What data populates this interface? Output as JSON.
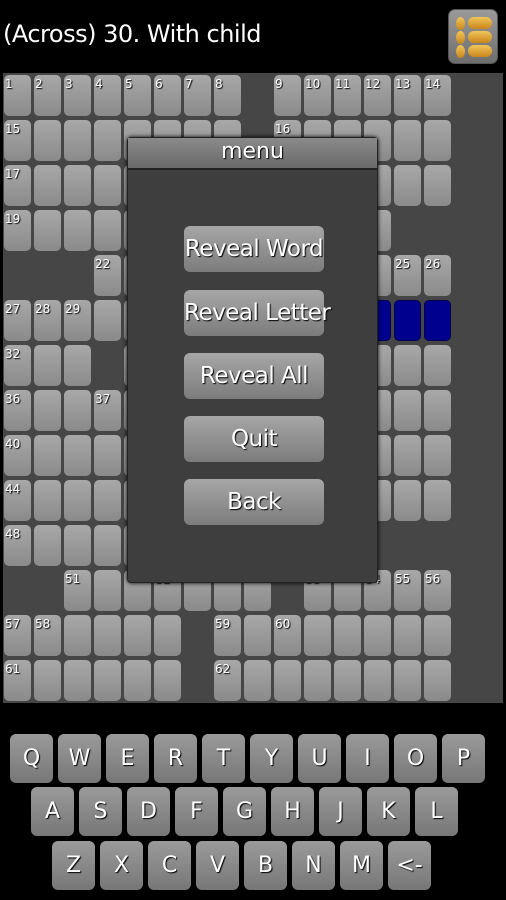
{
  "header": {
    "clue": "(Across) 30. With child",
    "menu_icon": "list-menu-icon"
  },
  "board": {
    "rows": [
      "........#......",
      "........#......",
      "...............",
      ".............##",
      "###............",
      "...............",
      "...#...........",
      "...............",
      "...............",
      "...............",
      "............###",
      "##.......#.....",
      "......#........",
      "......#........"
    ],
    "selected_cells": [
      [
        5,
        12
      ],
      [
        5,
        13
      ],
      [
        5,
        14
      ]
    ],
    "numbers": [
      {
        "n": "1",
        "r": 0,
        "c": 0
      },
      {
        "n": "2",
        "r": 0,
        "c": 1
      },
      {
        "n": "3",
        "r": 0,
        "c": 2
      },
      {
        "n": "4",
        "r": 0,
        "c": 3
      },
      {
        "n": "5",
        "r": 0,
        "c": 4
      },
      {
        "n": "6",
        "r": 0,
        "c": 5
      },
      {
        "n": "7",
        "r": 0,
        "c": 6
      },
      {
        "n": "8",
        "r": 0,
        "c": 7
      },
      {
        "n": "9",
        "r": 0,
        "c": 9
      },
      {
        "n": "10",
        "r": 0,
        "c": 10
      },
      {
        "n": "11",
        "r": 0,
        "c": 11
      },
      {
        "n": "12",
        "r": 0,
        "c": 12
      },
      {
        "n": "13",
        "r": 0,
        "c": 13
      },
      {
        "n": "14",
        "r": 0,
        "c": 14
      },
      {
        "n": "15",
        "r": 1,
        "c": 0
      },
      {
        "n": "16",
        "r": 1,
        "c": 9
      },
      {
        "n": "17",
        "r": 2,
        "c": 0
      },
      {
        "n": "19",
        "r": 3,
        "c": 0
      },
      {
        "n": "22",
        "r": 4,
        "c": 3
      },
      {
        "n": "25",
        "r": 4,
        "c": 13
      },
      {
        "n": "26",
        "r": 4,
        "c": 14
      },
      {
        "n": "27",
        "r": 5,
        "c": 0
      },
      {
        "n": "28",
        "r": 5,
        "c": 1
      },
      {
        "n": "29",
        "r": 5,
        "c": 2
      },
      {
        "n": "32",
        "r": 6,
        "c": 0
      },
      {
        "n": "36",
        "r": 7,
        "c": 0
      },
      {
        "n": "37",
        "r": 7,
        "c": 3
      },
      {
        "n": "40",
        "r": 8,
        "c": 0
      },
      {
        "n": "44",
        "r": 9,
        "c": 0
      },
      {
        "n": "48",
        "r": 10,
        "c": 0
      },
      {
        "n": "51",
        "r": 11,
        "c": 2
      },
      {
        "n": "52",
        "r": 11,
        "c": 5
      },
      {
        "n": "53",
        "r": 11,
        "c": 10
      },
      {
        "n": "54",
        "r": 11,
        "c": 12
      },
      {
        "n": "55",
        "r": 11,
        "c": 13
      },
      {
        "n": "56",
        "r": 11,
        "c": 14
      },
      {
        "n": "57",
        "r": 12,
        "c": 0
      },
      {
        "n": "58",
        "r": 12,
        "c": 1
      },
      {
        "n": "59",
        "r": 12,
        "c": 7
      },
      {
        "n": "60",
        "r": 12,
        "c": 9
      },
      {
        "n": "61",
        "r": 13,
        "c": 0
      },
      {
        "n": "62",
        "r": 13,
        "c": 7
      }
    ],
    "colors": {
      "cell": "#999999",
      "selected": "#00008f",
      "background": "#464646"
    }
  },
  "menu": {
    "title": "menu",
    "buttons": [
      "Reveal Word",
      "Reveal Letter",
      "Reveal All",
      "Quit",
      "Back"
    ]
  },
  "keyboard": {
    "rows": [
      [
        "Q",
        "W",
        "E",
        "R",
        "T",
        "Y",
        "U",
        "I",
        "O",
        "P"
      ],
      [
        "A",
        "S",
        "D",
        "F",
        "G",
        "H",
        "J",
        "K",
        "L"
      ],
      [
        "Z",
        "X",
        "C",
        "V",
        "B",
        "N",
        "M",
        "<-"
      ]
    ]
  }
}
